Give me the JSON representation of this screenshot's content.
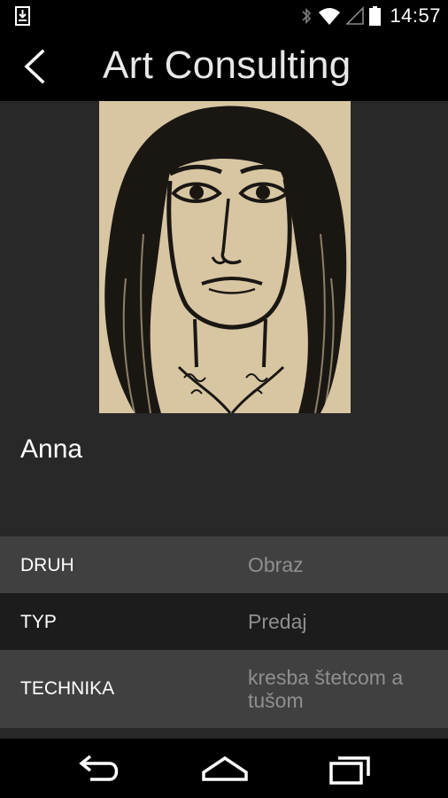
{
  "status_bar": {
    "time": "14:57",
    "icons": [
      "download-icon",
      "bluetooth-icon",
      "wifi-icon",
      "signal-icon",
      "battery-icon"
    ]
  },
  "app_bar": {
    "title": "Art Consulting",
    "back_icon": "chevron-left-icon"
  },
  "artwork": {
    "name": "Anna"
  },
  "details": [
    {
      "label": "DRUH",
      "value": "Obraz"
    },
    {
      "label": "TYP",
      "value": "Predaj"
    },
    {
      "label": "TECHNIKA",
      "value": "kresba štetcom a tušom"
    }
  ],
  "nav_bar": {
    "icons": [
      "back-icon",
      "home-icon",
      "recents-icon"
    ]
  },
  "colors": {
    "background": "#282828",
    "bar": "#000000",
    "row_light": "#404040",
    "row_dark": "#1c1c1c",
    "value_text": "#8f8f8f"
  }
}
